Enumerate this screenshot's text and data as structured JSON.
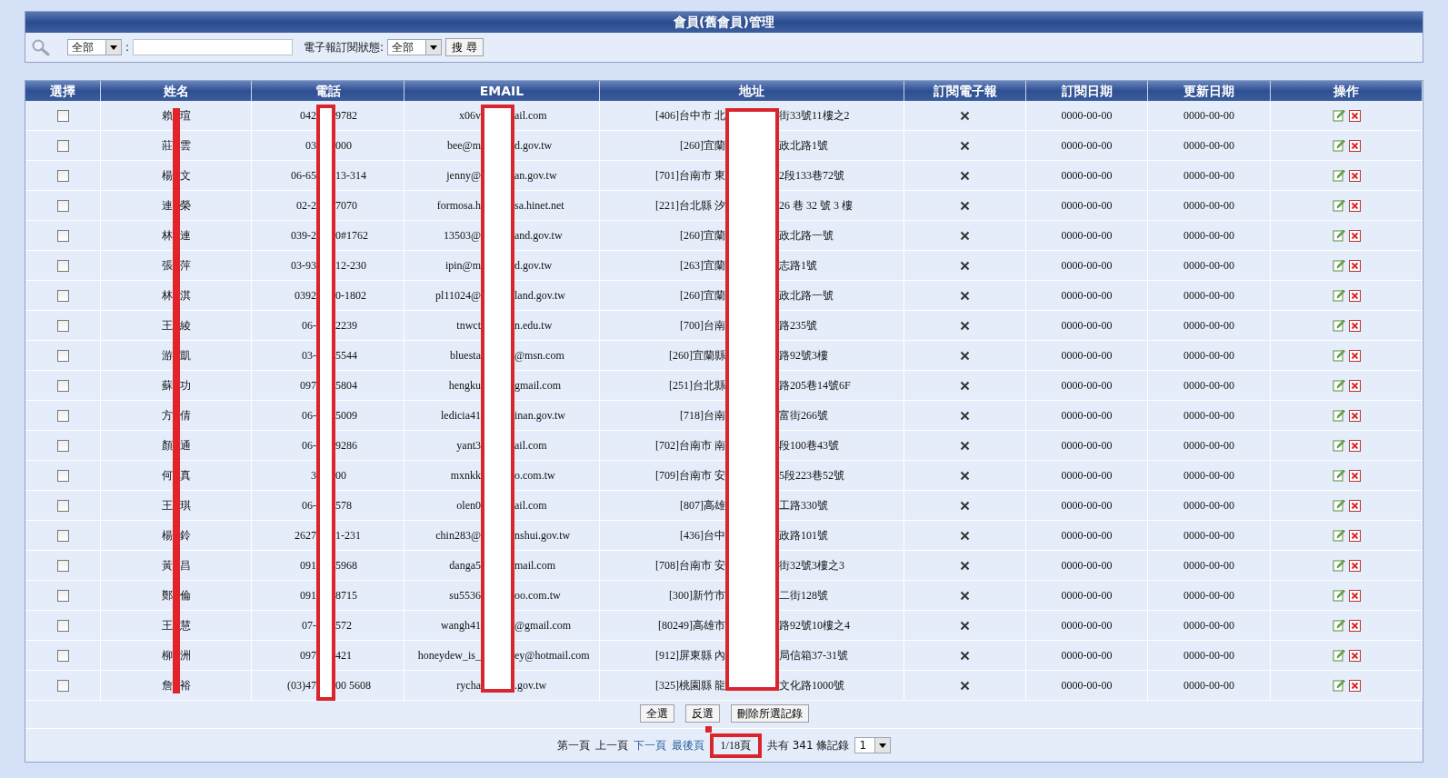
{
  "title": "會員(舊會員)管理",
  "search": {
    "field_select": "全部",
    "separator": ":",
    "status_label": "電子報訂閱狀態:",
    "status_select": "全部",
    "button": "搜 尋"
  },
  "table": {
    "columns": [
      "選擇",
      "姓名",
      "電話",
      "EMAIL",
      "地址",
      "訂閱電子報",
      "訂閱日期",
      "更新日期",
      "操作"
    ],
    "rows": [
      {
        "selected": false,
        "name": [
          "賴",
          "瑄"
        ],
        "phone": [
          "042",
          "9782"
        ],
        "email": [
          "x06v",
          "ail.com"
        ],
        "address": [
          "[406]台中市 北",
          "街33號11樓之2"
        ],
        "subscribed": false,
        "subscribe_date": "0000-00-00",
        "update_date": "0000-00-00"
      },
      {
        "selected": false,
        "name": [
          "莊",
          "雲"
        ],
        "phone": [
          "03",
          "000"
        ],
        "email": [
          "bee@m",
          "d.gov.tw"
        ],
        "address": [
          "[260]宜蘭",
          "政北路1號"
        ],
        "subscribed": false,
        "subscribe_date": "0000-00-00",
        "update_date": "0000-00-00"
      },
      {
        "selected": false,
        "name": [
          "楊",
          "文"
        ],
        "phone": [
          "06-65",
          "13-314"
        ],
        "email": [
          "jenny@",
          "an.gov.tw"
        ],
        "address": [
          "[701]台南市 東",
          "2段133巷72號"
        ],
        "subscribed": false,
        "subscribe_date": "0000-00-00",
        "update_date": "0000-00-00"
      },
      {
        "selected": false,
        "name": [
          "連",
          "榮"
        ],
        "phone": [
          "02-2",
          "7070"
        ],
        "email": [
          "formosa.h",
          "sa.hinet.net"
        ],
        "address": [
          "[221]台北縣 汐",
          "26 巷 32 號 3 樓"
        ],
        "subscribed": false,
        "subscribe_date": "0000-00-00",
        "update_date": "0000-00-00"
      },
      {
        "selected": false,
        "name": [
          "林",
          "連"
        ],
        "phone": [
          "039-2",
          "0#1762"
        ],
        "email": [
          "13503@",
          "and.gov.tw"
        ],
        "address": [
          "[260]宜蘭",
          "政北路一號"
        ],
        "subscribed": false,
        "subscribe_date": "0000-00-00",
        "update_date": "0000-00-00"
      },
      {
        "selected": false,
        "name": [
          "張",
          "萍"
        ],
        "phone": [
          "03-93",
          "12-230"
        ],
        "email": [
          "ipin@m",
          "d.gov.tw"
        ],
        "address": [
          "[263]宜蘭",
          "志路1號"
        ],
        "subscribed": false,
        "subscribe_date": "0000-00-00",
        "update_date": "0000-00-00"
      },
      {
        "selected": false,
        "name": [
          "林",
          "淇"
        ],
        "phone": [
          "0392",
          "0-1802"
        ],
        "email": [
          "pl11024@",
          "land.gov.tw"
        ],
        "address": [
          "[260]宜蘭",
          "政北路一號"
        ],
        "subscribed": false,
        "subscribe_date": "0000-00-00",
        "update_date": "0000-00-00"
      },
      {
        "selected": false,
        "name": [
          "王",
          "綾"
        ],
        "phone": [
          "06-",
          "2239"
        ],
        "email": [
          "tnwct",
          "n.edu.tw"
        ],
        "address": [
          "[700]台南",
          "路235號"
        ],
        "subscribed": false,
        "subscribe_date": "0000-00-00",
        "update_date": "0000-00-00"
      },
      {
        "selected": false,
        "name": [
          "游",
          "凱"
        ],
        "phone": [
          "03-",
          "5544"
        ],
        "email": [
          "bluesta",
          "@msn.com"
        ],
        "address": [
          "[260]宜蘭縣",
          "路92號3樓"
        ],
        "subscribed": false,
        "subscribe_date": "0000-00-00",
        "update_date": "0000-00-00"
      },
      {
        "selected": false,
        "name": [
          "蘇",
          "功"
        ],
        "phone": [
          "097",
          "5804"
        ],
        "email": [
          "hengku",
          "gmail.com"
        ],
        "address": [
          "[251]台北縣",
          "路205巷14號6F"
        ],
        "subscribed": false,
        "subscribe_date": "0000-00-00",
        "update_date": "0000-00-00"
      },
      {
        "selected": false,
        "name": [
          "方",
          "倩"
        ],
        "phone": [
          "06-",
          "5009"
        ],
        "email": [
          "ledicia41",
          "inan.gov.tw"
        ],
        "address": [
          "[718]台南",
          "富街266號"
        ],
        "subscribed": false,
        "subscribe_date": "0000-00-00",
        "update_date": "0000-00-00"
      },
      {
        "selected": false,
        "name": [
          "顏",
          "通"
        ],
        "phone": [
          "06-",
          "9286"
        ],
        "email": [
          "yant3",
          "ail.com"
        ],
        "address": [
          "[702]台南市 南",
          "段100巷43號"
        ],
        "subscribed": false,
        "subscribe_date": "0000-00-00",
        "update_date": "0000-00-00"
      },
      {
        "selected": false,
        "name": [
          "何",
          "真"
        ],
        "phone": [
          "3",
          "00"
        ],
        "email": [
          "mxnkk",
          "o.com.tw"
        ],
        "address": [
          "[709]台南市 安",
          "5段223巷52號"
        ],
        "subscribed": false,
        "subscribe_date": "0000-00-00",
        "update_date": "0000-00-00"
      },
      {
        "selected": false,
        "name": [
          "王",
          "琪"
        ],
        "phone": [
          "06-",
          "578"
        ],
        "email": [
          "olen0",
          "ail.com"
        ],
        "address": [
          "[807]高雄",
          "工路330號"
        ],
        "subscribed": false,
        "subscribe_date": "0000-00-00",
        "update_date": "0000-00-00"
      },
      {
        "selected": false,
        "name": [
          "楊",
          "鈴"
        ],
        "phone": [
          "2627",
          "1-231"
        ],
        "email": [
          "chin283@",
          "nshui.gov.tw"
        ],
        "address": [
          "[436]台中",
          "政路101號"
        ],
        "subscribed": false,
        "subscribe_date": "0000-00-00",
        "update_date": "0000-00-00"
      },
      {
        "selected": false,
        "name": [
          "黃",
          "昌"
        ],
        "phone": [
          "091",
          "5968"
        ],
        "email": [
          "danga5",
          "mail.com"
        ],
        "address": [
          "[708]台南市 安",
          "街32號3樓之3"
        ],
        "subscribed": false,
        "subscribe_date": "0000-00-00",
        "update_date": "0000-00-00"
      },
      {
        "selected": false,
        "name": [
          "鄭",
          "倫"
        ],
        "phone": [
          "091",
          "8715"
        ],
        "email": [
          "su5536",
          "oo.com.tw"
        ],
        "address": [
          "[300]新竹市",
          "二街128號"
        ],
        "subscribed": false,
        "subscribe_date": "0000-00-00",
        "update_date": "0000-00-00"
      },
      {
        "selected": false,
        "name": [
          "王",
          "慧"
        ],
        "phone": [
          "07-",
          "572"
        ],
        "email": [
          "wangh41",
          "@gmail.com"
        ],
        "address": [
          "[80249]高雄市",
          "路92號10樓之4"
        ],
        "subscribed": false,
        "subscribe_date": "0000-00-00",
        "update_date": "0000-00-00"
      },
      {
        "selected": false,
        "name": [
          "柳",
          "洲"
        ],
        "phone": [
          "097",
          "421"
        ],
        "email": [
          "honeydew_is_",
          "ey@hotmail.com"
        ],
        "address": [
          "[912]屏東縣 內",
          "局信箱37-31號"
        ],
        "subscribed": false,
        "subscribe_date": "0000-00-00",
        "update_date": "0000-00-00"
      },
      {
        "selected": false,
        "name": [
          "詹",
          "裕"
        ],
        "phone": [
          "(03)47",
          "00 5608"
        ],
        "email": [
          "rycha",
          ".gov.tw"
        ],
        "address": [
          "[325]桃園縣 龍",
          "文化路1000號"
        ],
        "subscribed": false,
        "subscribe_date": "0000-00-00",
        "update_date": "0000-00-00"
      }
    ]
  },
  "actions": [
    "全選",
    "反選",
    "刪除所選記錄"
  ],
  "pagination": {
    "links": [
      {
        "label": "第一頁",
        "enabled": false
      },
      {
        "label": "上一頁",
        "enabled": false
      },
      {
        "label": "下一頁",
        "enabled": true
      },
      {
        "label": "最後頁",
        "enabled": true
      }
    ],
    "page": "1/18頁",
    "total": "共有 341 條記錄",
    "page_select": "1"
  }
}
